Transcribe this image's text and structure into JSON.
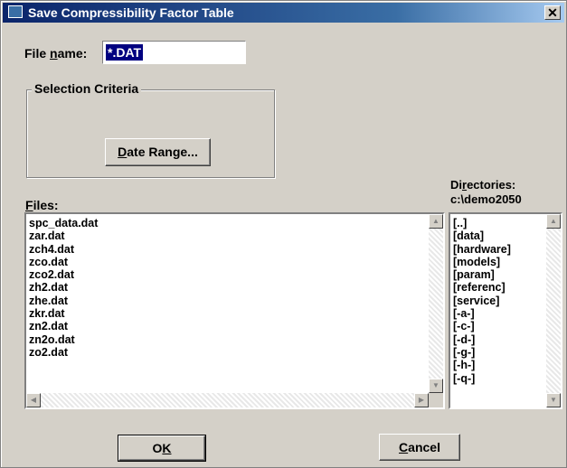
{
  "window": {
    "title": "Save Compressibility Factor Table",
    "close_glyph": "✕"
  },
  "filename": {
    "label_pre": "File ",
    "label_key": "n",
    "label_post": "ame:",
    "value": "*.DAT"
  },
  "selection": {
    "group_title": "Selection Criteria",
    "date_range_key": "D",
    "date_range_rest": "ate Range..."
  },
  "files": {
    "label_key": "F",
    "label_rest": "iles:",
    "items": [
      "spc_data.dat",
      "zar.dat",
      "zch4.dat",
      "zco.dat",
      "zco2.dat",
      "zh2.dat",
      "zhe.dat",
      "zkr.dat",
      "zn2.dat",
      "zn2o.dat",
      "zo2.dat"
    ]
  },
  "directories": {
    "label_pre": "Di",
    "label_key": "r",
    "label_post": "ectories:",
    "path": "c:\\demo2050",
    "items": [
      "[..]",
      "[data]",
      "[hardware]",
      "[models]",
      "[param]",
      "[referenc]",
      "[service]",
      "[-a-]",
      "[-c-]",
      "[-d-]",
      "[-g-]",
      "[-h-]",
      "[-q-]"
    ]
  },
  "buttons": {
    "ok_pre": "O",
    "ok_key": "K",
    "cancel_key": "C",
    "cancel_rest": "ancel"
  },
  "icons": {
    "scroll_up": "▲",
    "scroll_down": "▼",
    "scroll_left": "◀",
    "scroll_right": "▶"
  }
}
